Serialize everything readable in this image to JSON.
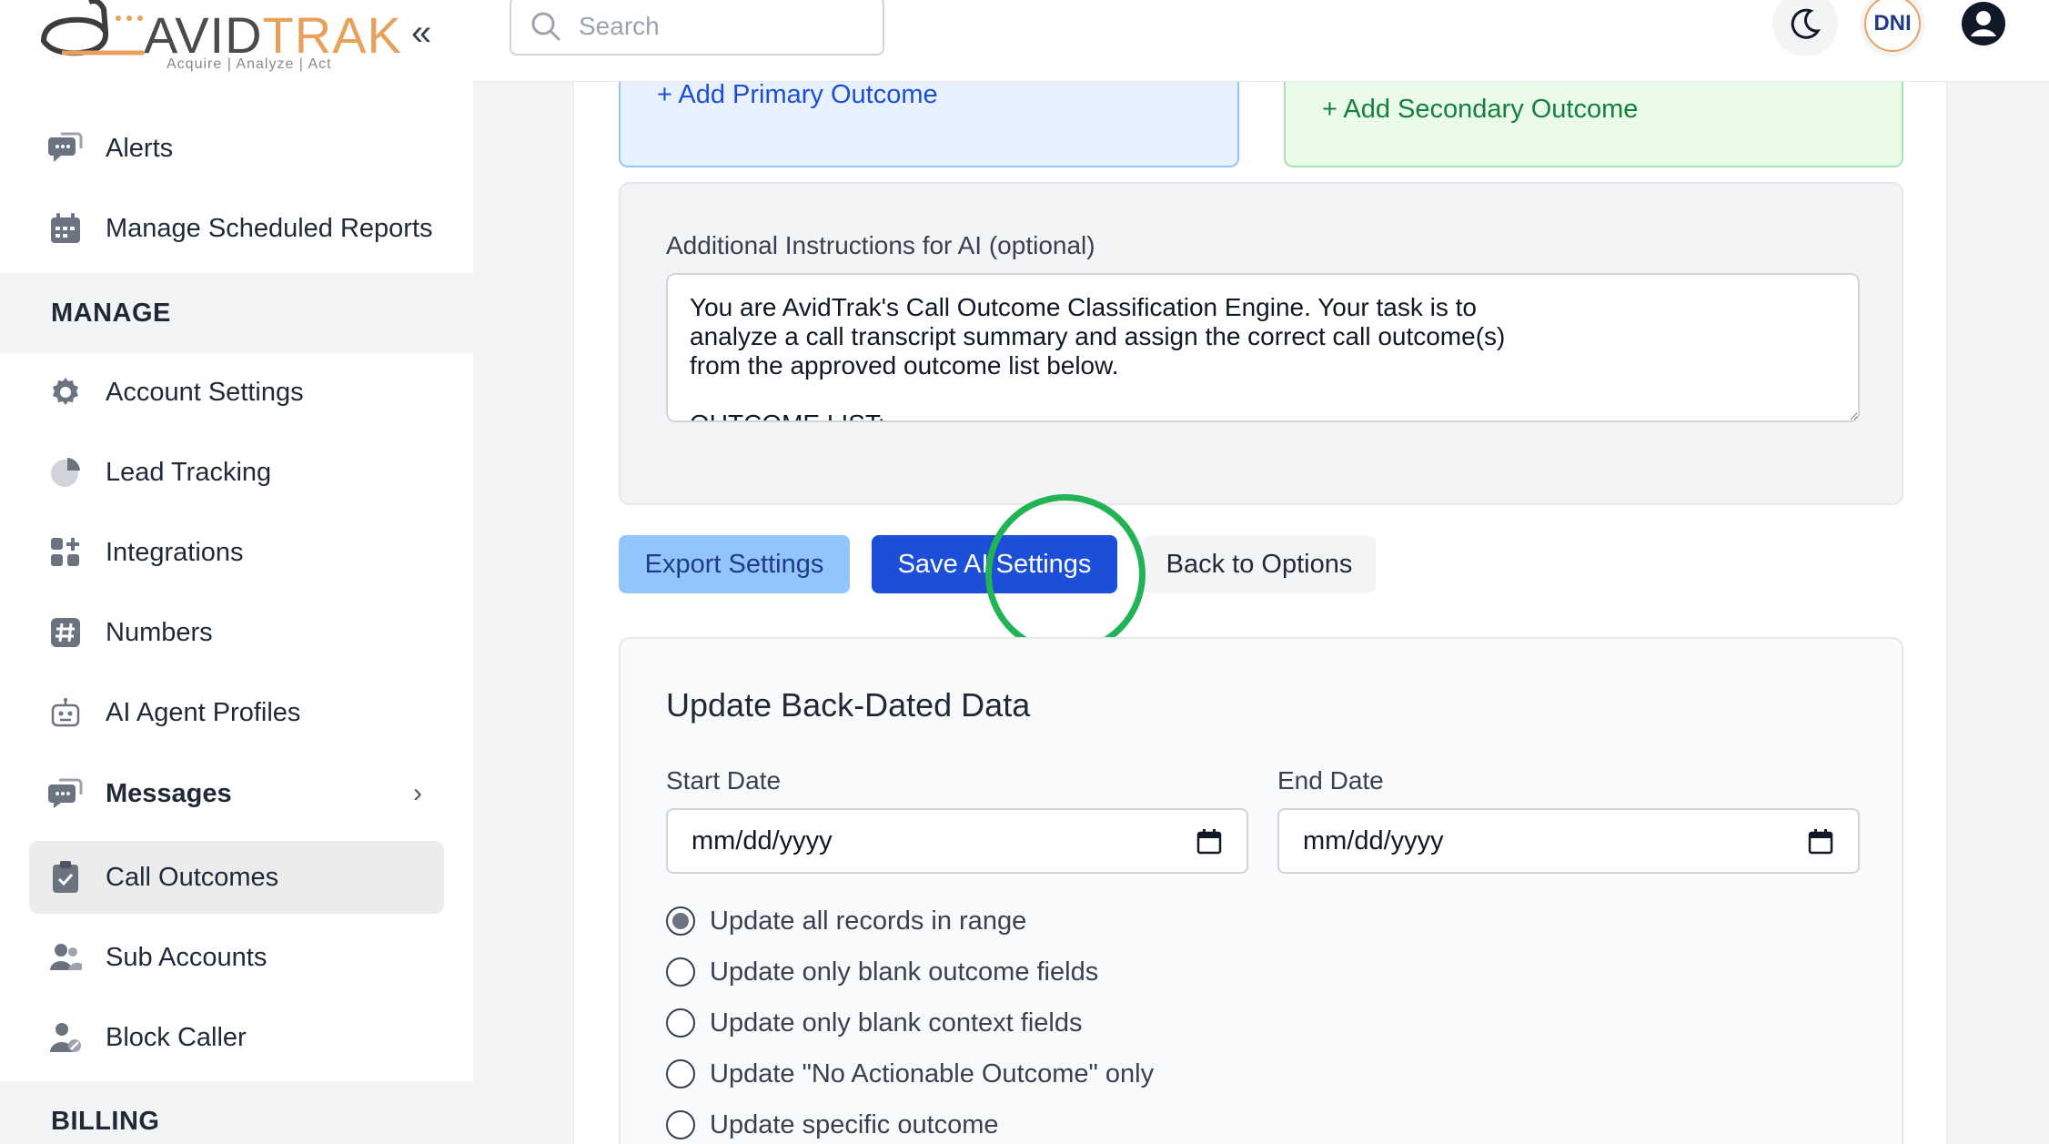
{
  "app": {
    "logo_brand": "AVIDTRAK",
    "logo_brand_a": "AVID",
    "logo_brand_b": "TRAK",
    "logo_tagline": "Acquire | Analyze | Act",
    "collapse_label": "«"
  },
  "sidebar": {
    "items_top": [
      {
        "label": "Alerts",
        "icon": "chat-bubble-icon"
      },
      {
        "label": "Manage Scheduled Reports",
        "icon": "calendar-icon"
      }
    ],
    "section_manage": "MANAGE",
    "items_manage": [
      {
        "label": "Account Settings",
        "icon": "gear-icon"
      },
      {
        "label": "Lead Tracking",
        "icon": "pie-chart-icon"
      },
      {
        "label": "Integrations",
        "icon": "grid-plus-icon"
      },
      {
        "label": "Numbers",
        "icon": "hash-icon"
      },
      {
        "label": "AI Agent Profiles",
        "icon": "robot-icon"
      },
      {
        "label": "Messages",
        "icon": "chat-bubble-icon",
        "chevron": "›"
      },
      {
        "label": "Call Outcomes",
        "icon": "clipboard-check-icon",
        "active": true
      },
      {
        "label": "Sub Accounts",
        "icon": "users-icon"
      },
      {
        "label": "Block Caller",
        "icon": "user-block-icon"
      }
    ],
    "section_billing": "BILLING"
  },
  "topbar": {
    "search_placeholder": "Search",
    "dni_label": "DNI"
  },
  "outcomes": {
    "add_primary": "+ Add Primary Outcome",
    "add_secondary": "+ Add Secondary Outcome"
  },
  "ai_instructions": {
    "label": "Additional Instructions for AI (optional)",
    "value": "You are AvidTrak's Call Outcome Classification Engine. Your task is to\nanalyze a call transcript summary and assign the correct call outcome(s)\nfrom the approved outcome list below.\n\nOUTCOME LIST:"
  },
  "actions": {
    "export": "Export Settings",
    "save": "Save AI Settings",
    "back": "Back to Options"
  },
  "backdated": {
    "title": "Update Back-Dated Data",
    "start_label": "Start Date",
    "end_label": "End Date",
    "start_value": "mm/dd/yyyy",
    "end_value": "mm/dd/yyyy",
    "options": [
      {
        "label": "Update all records in range",
        "checked": true
      },
      {
        "label": "Update only blank outcome fields",
        "checked": false
      },
      {
        "label": "Update only blank context fields",
        "checked": false
      },
      {
        "label": "Update \"No Actionable Outcome\" only",
        "checked": false
      },
      {
        "label": "Update specific outcome",
        "checked": false
      }
    ]
  },
  "colors": {
    "primary": "#1d4ed8",
    "highlight_ring": "#22b357",
    "brand_orange": "#e8a15b"
  }
}
